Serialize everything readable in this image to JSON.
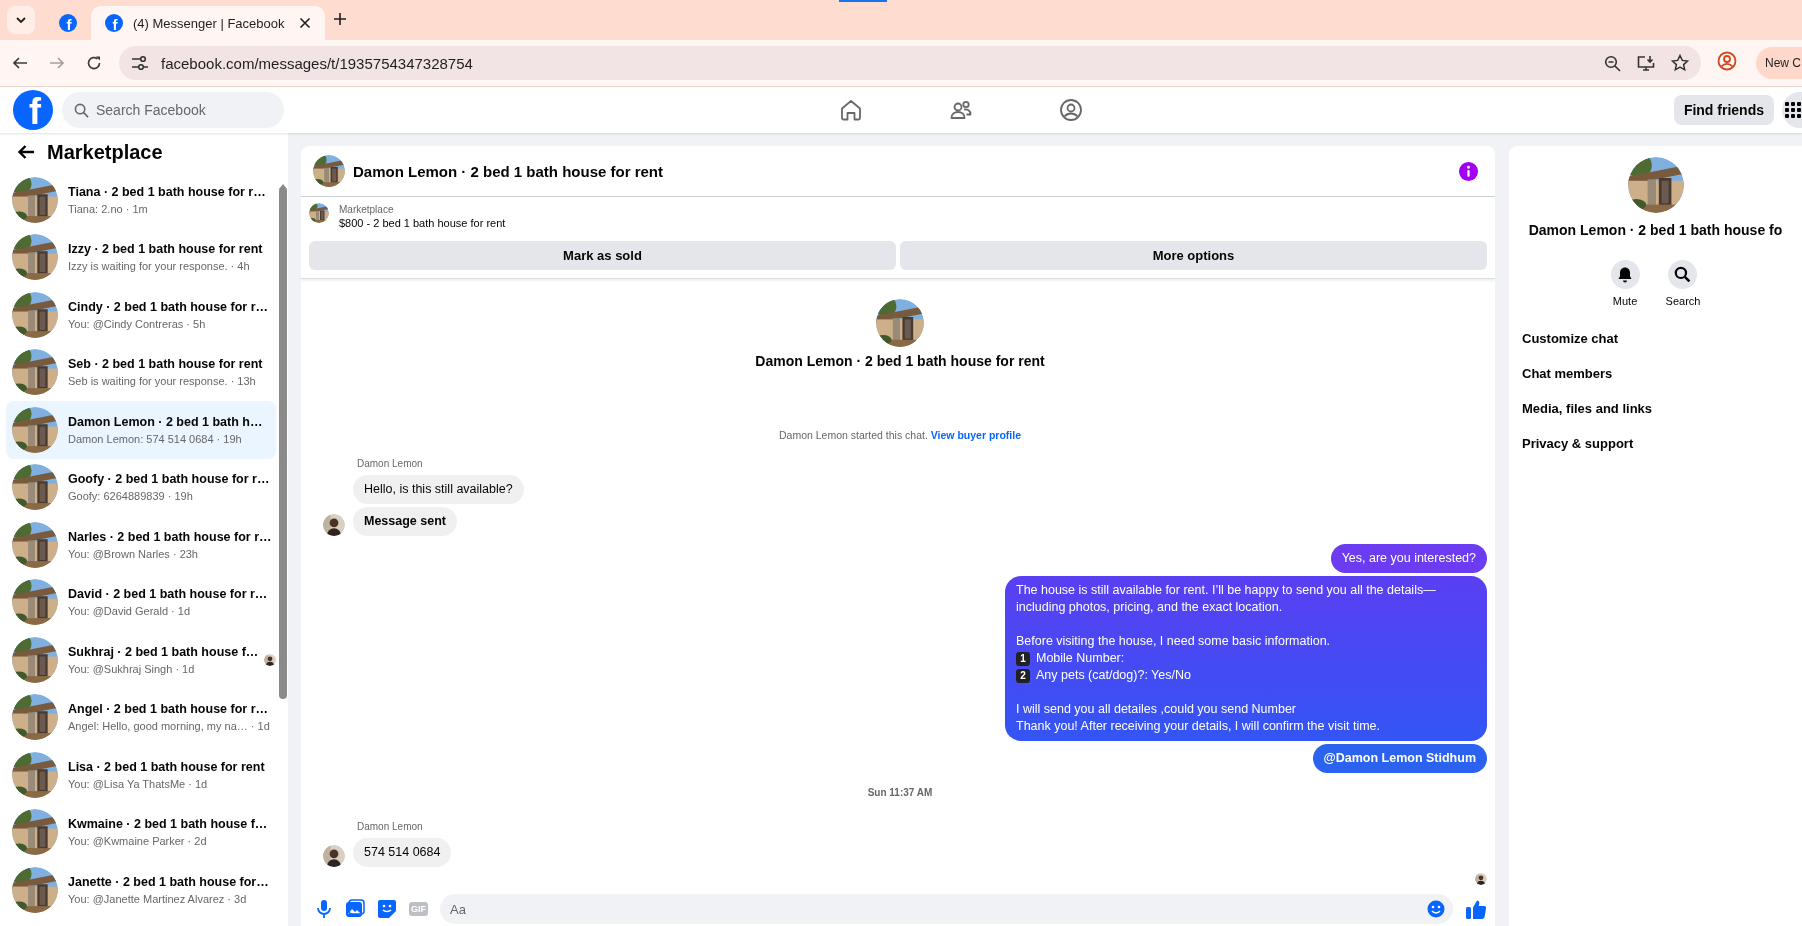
{
  "browser": {
    "tabs": [
      {
        "favicon": "f",
        "selected": false
      },
      {
        "favicon": "f",
        "title": "(4) Messenger | Facebook",
        "selected": true
      }
    ],
    "url": "facebook.com/messages/t/1935754347328754",
    "profile_button": "New C"
  },
  "header": {
    "logo": "f",
    "search_placeholder": "Search Facebook",
    "nav": [
      {
        "kind": "home"
      },
      {
        "kind": "friends"
      },
      {
        "kind": "profile"
      }
    ],
    "find_friends": "Find friends"
  },
  "sidebar": {
    "title": "Marketplace",
    "threads": [
      {
        "title": "Tiana · 2 bed 1 bath house for r…",
        "subtitle": "Tiana: 2.no · 1m",
        "selected": false,
        "read_receipt": false
      },
      {
        "title": "Izzy · 2 bed 1 bath house for rent",
        "subtitle": "Izzy is waiting for your response. · 4h",
        "selected": false,
        "read_receipt": false
      },
      {
        "title": "Cindy · 2 bed 1 bath house for r…",
        "subtitle": "You: @Cindy Contreras · 5h",
        "selected": false,
        "read_receipt": false
      },
      {
        "title": "Seb · 2 bed 1 bath house for rent",
        "subtitle": "Seb is waiting for your response. · 13h",
        "selected": false,
        "read_receipt": false
      },
      {
        "title": "Damon Lemon · 2 bed 1 bath h…",
        "subtitle": "Damon Lemon: 574 514 0684 · 19h",
        "selected": true,
        "read_receipt": false
      },
      {
        "title": "Goofy · 2 bed 1 bath house for r…",
        "subtitle": "Goofy: 6264889839 · 19h",
        "selected": false,
        "read_receipt": false
      },
      {
        "title": "Narles · 2 bed 1 bath house for r…",
        "subtitle": "You: @Brown Narles · 23h",
        "selected": false,
        "read_receipt": false
      },
      {
        "title": "David · 2 bed 1 bath house for r…",
        "subtitle": "You: @David Gerald · 1d",
        "selected": false,
        "read_receipt": false
      },
      {
        "title": "Sukhraj · 2 bed 1 bath house f…",
        "subtitle": "You: @Sukhraj Singh · 1d",
        "selected": false,
        "read_receipt": true
      },
      {
        "title": "Angel · 2 bed 1 bath house for r…",
        "subtitle": "Angel: Hello, good morning, my na… · 1d",
        "selected": false,
        "read_receipt": false
      },
      {
        "title": "Lisa · 2 bed 1 bath house for rent",
        "subtitle": "You: @Lisa Ya ThatsMe · 1d",
        "selected": false,
        "read_receipt": false
      },
      {
        "title": "Kwmaine · 2 bed 1 bath house f…",
        "subtitle": "You: @Kwmaine Parker · 2d",
        "selected": false,
        "read_receipt": false
      },
      {
        "title": "Janette · 2 bed 1 bath house for…",
        "subtitle": "You: @Janette Martinez Alvarez · 3d",
        "selected": false,
        "read_receipt": false
      }
    ]
  },
  "chat": {
    "title": "Damon Lemon · 2 bed 1 bath house for rent",
    "listing": {
      "label": "Marketplace",
      "text": "$800 - 2 bed 1 bath house for rent"
    },
    "actions": [
      "Mark as sold",
      "More options"
    ],
    "intro": {
      "name": "Damon Lemon · 2 bed 1 bath house for rent",
      "started": "Damon Lemon started this chat.",
      "link": "View buyer profile"
    },
    "items": [
      {
        "kind": "sender",
        "text": "Damon Lemon"
      },
      {
        "kind": "incoming",
        "bold": false,
        "avatar": false,
        "text": "Hello, is this still available?"
      },
      {
        "kind": "incoming",
        "bold": true,
        "avatar": true,
        "text": "Message sent"
      },
      {
        "kind": "outgoing",
        "bold": false,
        "text": "Yes, are you interested?"
      },
      {
        "kind": "outgoing",
        "bold": false,
        "blocks": [
          {
            "kind": "text",
            "gap": false,
            "text": "The house is still available for rent. I’ll be happy to send you all the details—including photos, pricing, and the exact location."
          },
          {
            "kind": "text",
            "gap": true,
            "text": "Before visiting the house, I need some basic information."
          },
          {
            "kind": "item",
            "gap": false,
            "marker": "1",
            "text": "Mobile Number:"
          },
          {
            "kind": "item",
            "gap": false,
            "marker": "2",
            "text": "Any pets (cat/dog)?: Yes/No"
          },
          {
            "kind": "text",
            "gap": true,
            "text": "I will send you all detailes ,could you send Number"
          },
          {
            "kind": "text",
            "gap": false,
            "text": "Thank you! After receiving your details, I will confirm the visit time."
          }
        ]
      },
      {
        "kind": "outgoing",
        "bold": true,
        "text": "@Damon Lemon Stidhum"
      },
      {
        "kind": "time",
        "text": "Sun 11:37 AM"
      },
      {
        "kind": "sender",
        "text": "Damon Lemon"
      },
      {
        "kind": "incoming",
        "bold": false,
        "avatar": true,
        "text": "574 514 0684"
      }
    ],
    "seen": true,
    "composer": {
      "placeholder": "Aa",
      "gif": "GIF"
    }
  },
  "details": {
    "name": "Damon Lemon · 2 bed 1 bath house fo",
    "actions": [
      {
        "kind": "mute",
        "label": "Mute"
      },
      {
        "kind": "search",
        "label": "Search"
      }
    ],
    "menu": [
      "Customize chat",
      "Chat members",
      "Media, files and links",
      "Privacy & support"
    ]
  }
}
